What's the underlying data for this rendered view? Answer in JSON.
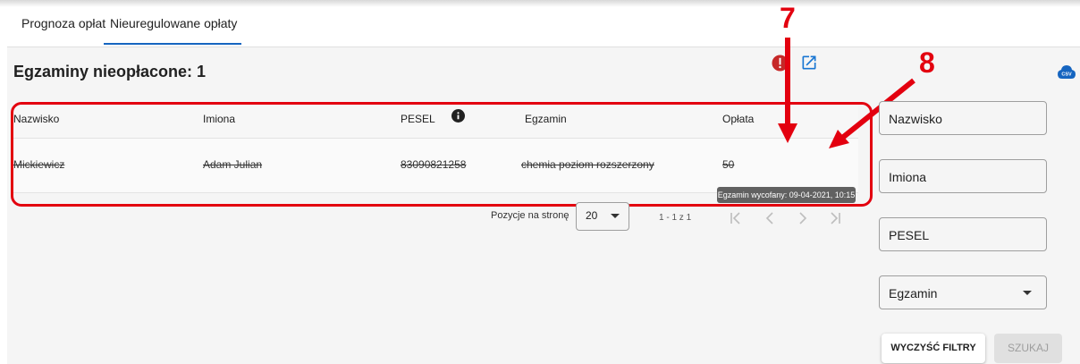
{
  "tabs": [
    {
      "label": "Prognoza opłat"
    },
    {
      "label": "Nieuregulowane opłaty",
      "active": true
    }
  ],
  "page_title": "Egzaminy nieopłacone: 1",
  "csv_icon_label": "CSV",
  "table": {
    "headers": [
      "Nazwisko",
      "Imiona",
      "PESEL",
      "Egzamin",
      "Opłata"
    ],
    "rows": [
      {
        "nazwisko": "Mickiewicz",
        "imiona": "Adam Julian",
        "pesel": "83090821258",
        "egzamin": "chemia poziom rozszerzony",
        "oplata": "50"
      }
    ]
  },
  "tooltip": "Egzamin wycofany: 09-04-2021, 10:15",
  "pagination": {
    "label": "Pozycje na stronę",
    "per_page": "20",
    "range": "1 - 1 z 1"
  },
  "filters": {
    "nazwisko": "Nazwisko",
    "imiona": "Imiona",
    "pesel": "PESEL",
    "egzamin": "Egzamin",
    "clear": "WYCZYŚĆ FILTRY",
    "search": "SZUKAJ"
  },
  "annotations": {
    "seven": "7",
    "eight": "8"
  },
  "colors": {
    "accent": "#1565c0",
    "annotation": "#e3000f",
    "info_red": "#c62828"
  }
}
